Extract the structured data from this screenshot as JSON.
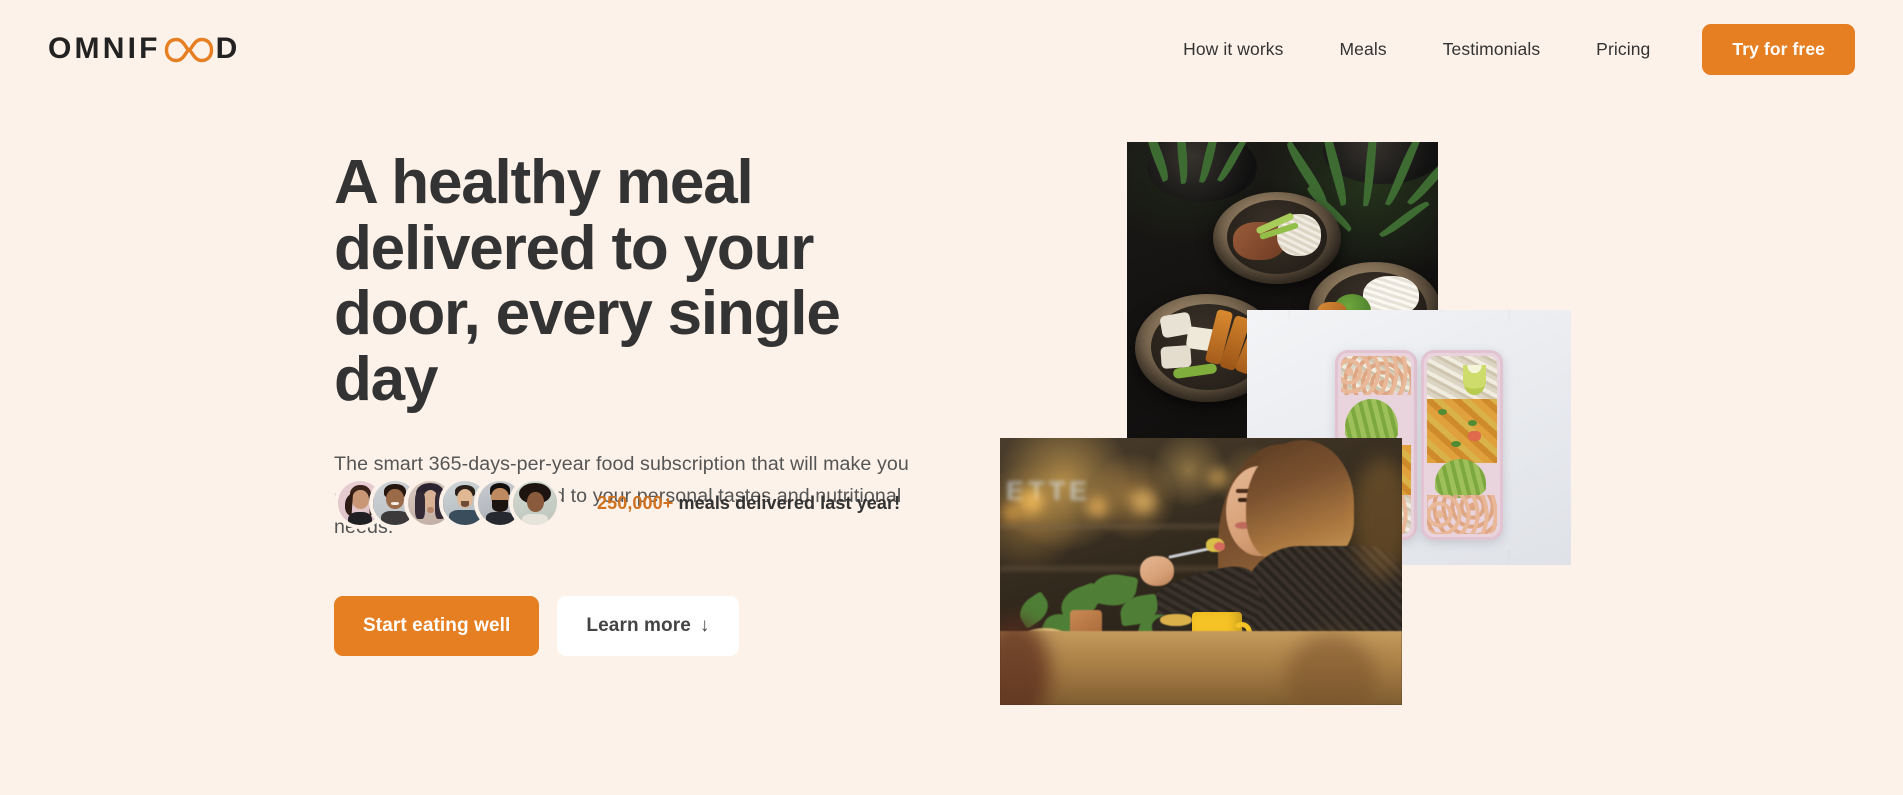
{
  "brand": {
    "logo_prefix": "OMNIF",
    "logo_infinity_icon": "infinity-icon",
    "logo_suffix": "D",
    "logo_full": "OMNIFOOD"
  },
  "colors": {
    "background": "#fdf2e9",
    "accent": "#e67e22",
    "accent_dark": "#cf711f",
    "text_dark": "#333333",
    "text_body": "#555555"
  },
  "header": {
    "nav": [
      {
        "label": "How it works"
      },
      {
        "label": "Meals"
      },
      {
        "label": "Testimonials"
      },
      {
        "label": "Pricing"
      }
    ],
    "cta": {
      "label": "Try for free"
    }
  },
  "hero": {
    "title": "A healthy meal delivered to your door, every single day",
    "description": "The smart 365-days-per-year food subscription that will make you eat healthy again. Tailored to your personal tastes and nutritional needs.",
    "primary_button": {
      "label": "Start eating well"
    },
    "secondary_button": {
      "label": "Learn more",
      "arrow": "↓"
    },
    "delivered": {
      "count": "250,000+",
      "text": " meals delivered last year!",
      "avatars": [
        {
          "name": "customer-1"
        },
        {
          "name": "customer-2"
        },
        {
          "name": "customer-3"
        },
        {
          "name": "customer-4"
        },
        {
          "name": "customer-5"
        },
        {
          "name": "customer-6"
        }
      ]
    },
    "images": [
      {
        "name": "hero-image-bowls",
        "alt": "Woman enjoying food bowls on a dark table with plants"
      },
      {
        "name": "hero-image-meal-prep",
        "alt": "Two meal prep containers with avocado, chickpeas and rice on marble"
      },
      {
        "name": "hero-image-cafe",
        "alt": "Woman eating a healthy meal in a warm lit cafe"
      }
    ]
  }
}
